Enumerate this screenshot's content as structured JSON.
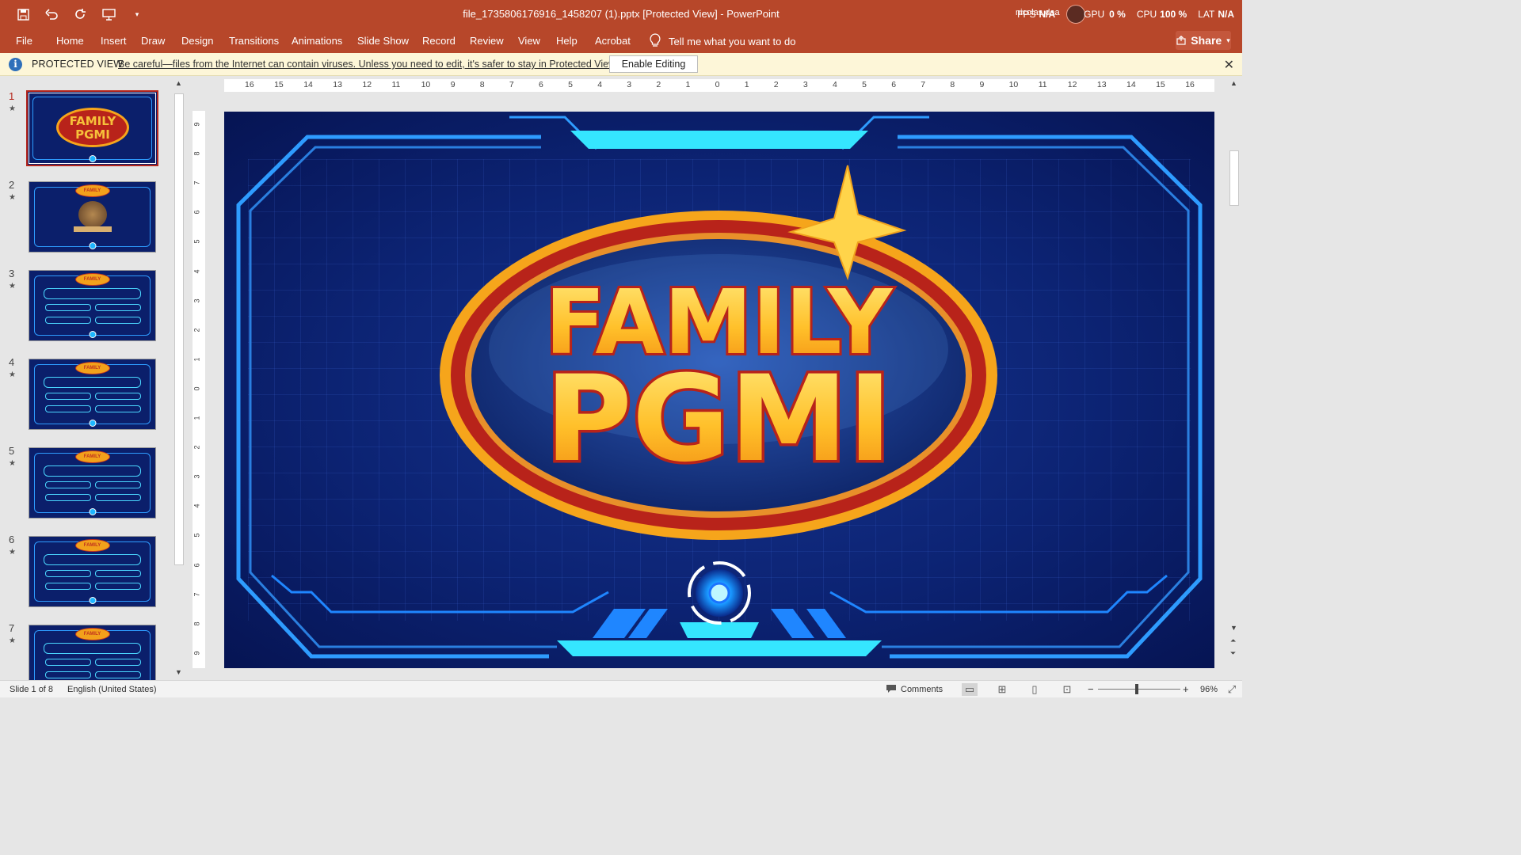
{
  "window": {
    "title": "file_1735806176916_1458207 (1).pptx [Protected View]  -  PowerPoint",
    "user": "nicolas.daa",
    "perf": {
      "fps_label": "FPS",
      "fps_value": "N/A",
      "gpu_label": "GPU",
      "gpu_value": "0 %",
      "cpu_label": "CPU",
      "cpu_value": "100 %",
      "lat_label": "LAT",
      "lat_value": "N/A"
    }
  },
  "ribbon": {
    "tabs": [
      "File",
      "Home",
      "Insert",
      "Draw",
      "Design",
      "Transitions",
      "Animations",
      "Slide Show",
      "Record",
      "Review",
      "View",
      "Help",
      "Acrobat"
    ],
    "tell_me": "Tell me what you want to do",
    "share": "Share"
  },
  "protected_view": {
    "label": "PROTECTED VIEW",
    "message": "Be careful—files from the Internet can contain viruses. Unless you need to edit, it's safer to stay in Protected View.",
    "button": "Enable Editing"
  },
  "thumbnails": [
    {
      "number": "1",
      "type": "title"
    },
    {
      "number": "2",
      "type": "emblem"
    },
    {
      "number": "3",
      "type": "question"
    },
    {
      "number": "4",
      "type": "question"
    },
    {
      "number": "5",
      "type": "question"
    },
    {
      "number": "6",
      "type": "question"
    },
    {
      "number": "7",
      "type": "question"
    }
  ],
  "ruler": {
    "horizontal": [
      "16",
      "15",
      "14",
      "13",
      "12",
      "11",
      "10",
      "9",
      "8",
      "7",
      "6",
      "5",
      "4",
      "3",
      "2",
      "1",
      "0",
      "1",
      "2",
      "3",
      "4",
      "5",
      "6",
      "7",
      "8",
      "9",
      "10",
      "11",
      "12",
      "13",
      "14",
      "15",
      "16"
    ],
    "vertical": [
      "9",
      "8",
      "7",
      "6",
      "5",
      "4",
      "3",
      "2",
      "1",
      "0",
      "1",
      "2",
      "3",
      "4",
      "5",
      "6",
      "7",
      "8",
      "9"
    ]
  },
  "slide": {
    "title_line1": "FAMILY",
    "title_line2": "PGMI",
    "colors": {
      "background": "#0c2373",
      "frame": "#2e9cff",
      "accent": "#35e6ff",
      "logo_gold": "#f6a51b",
      "logo_red": "#b8231a"
    }
  },
  "status": {
    "slide_of": "Slide 1 of 8",
    "language": "English (United States)",
    "comments": "Comments",
    "zoom": "96%"
  },
  "icons": [
    "save-icon",
    "undo-icon",
    "redo-icon",
    "present-icon",
    "customize-icon",
    "lightbulb-icon",
    "info-icon",
    "close-icon",
    "comments-icon",
    "normal-view-icon",
    "slide-sorter-icon",
    "reading-view-icon",
    "slideshow-icon",
    "fit-window-icon"
  ]
}
